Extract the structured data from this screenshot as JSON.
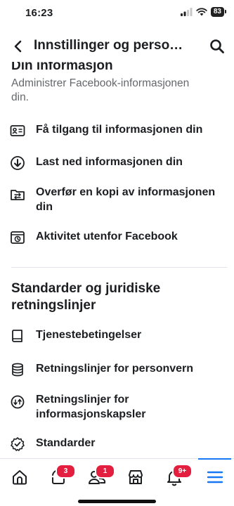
{
  "status": {
    "time": "16:23",
    "battery": "83"
  },
  "header": {
    "title": "Innstillinger og perso…"
  },
  "sections": {
    "info": {
      "title": "Din informasjon",
      "description": "Administrer Facebook-informasjonen din.",
      "items": [
        {
          "label": "Få tilgang til informasjonen din",
          "icon": "id-card-icon"
        },
        {
          "label": "Last ned informasjonen din",
          "icon": "download-icon"
        },
        {
          "label": "Overfør en kopi av informasjonen din",
          "icon": "transfer-icon"
        },
        {
          "label": "Aktivitet utenfor Facebook",
          "icon": "history-icon"
        }
      ]
    },
    "legal": {
      "title": "Standarder og juridiske retningslinjer",
      "items": [
        {
          "label": "Tjenestebetingelser",
          "icon": "book-icon"
        },
        {
          "label": "Retningslinjer for personvern",
          "icon": "database-icon"
        },
        {
          "label": "Retningslinjer for informasjonskapsler",
          "icon": "cookie-icon"
        },
        {
          "label": "Standarder",
          "icon": "badge-check-icon"
        }
      ]
    }
  },
  "tabs": [
    {
      "name": "home",
      "icon": "home-icon",
      "badge": ""
    },
    {
      "name": "watch",
      "icon": "video-icon",
      "badge": "3"
    },
    {
      "name": "friends",
      "icon": "friends-icon",
      "badge": "1"
    },
    {
      "name": "marketplace",
      "icon": "store-icon",
      "badge": ""
    },
    {
      "name": "notifications",
      "icon": "bell-icon",
      "badge": "9+"
    },
    {
      "name": "menu",
      "icon": "menu-icon",
      "badge": ""
    }
  ],
  "colors": {
    "accent": "#1877f2",
    "badge": "#e41e3f",
    "text": "#1c1e21",
    "secondary": "#65676b"
  }
}
